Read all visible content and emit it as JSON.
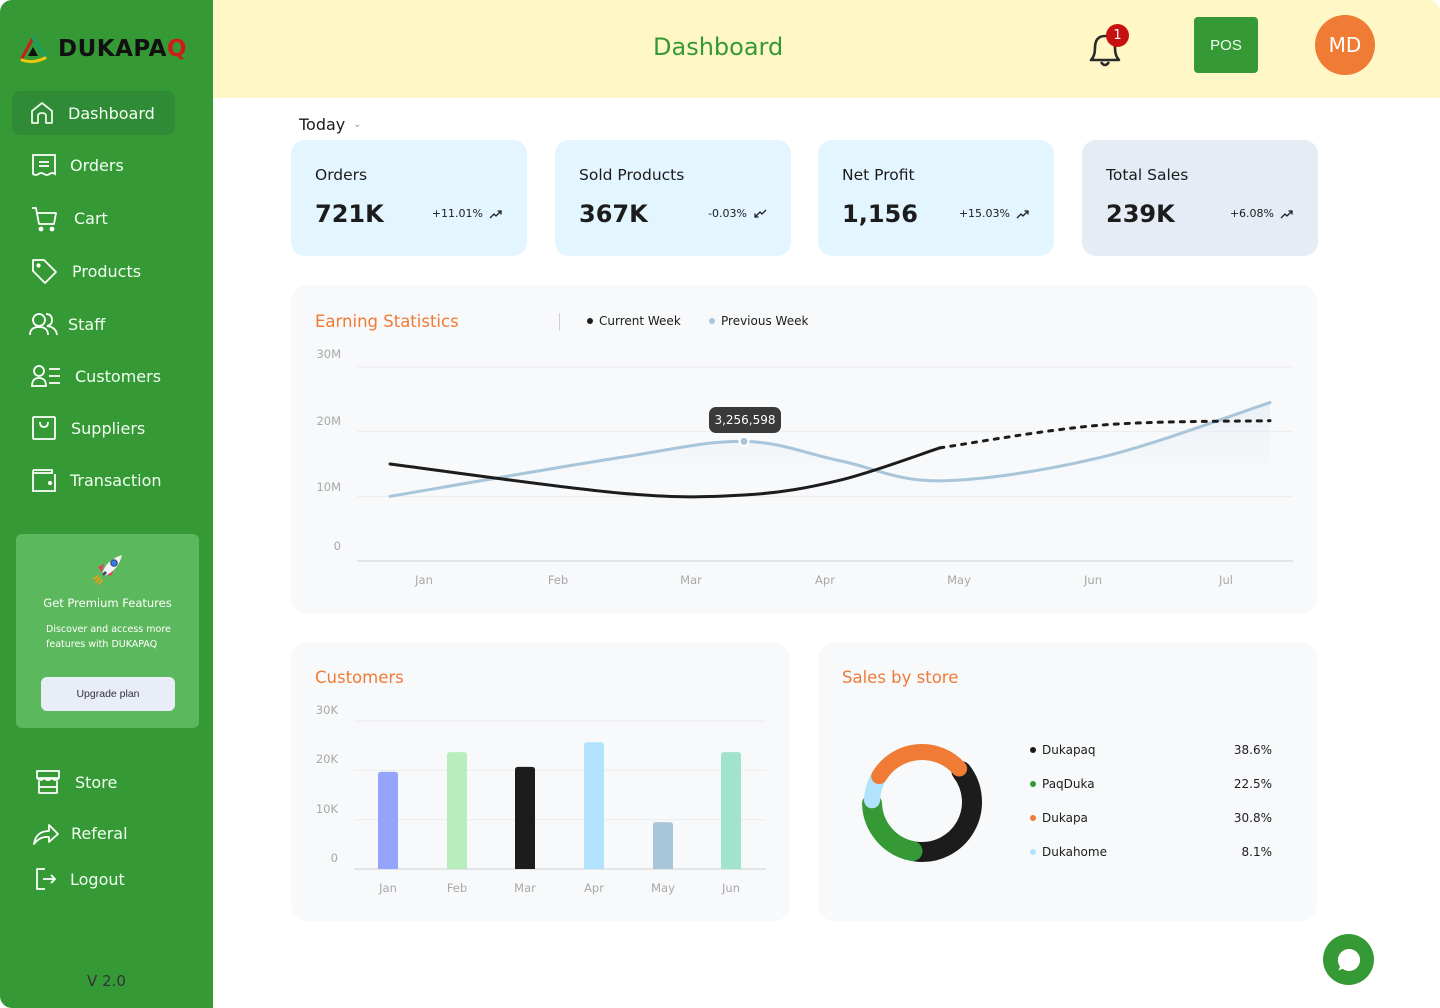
{
  "brand": {
    "name_main": "DUKAPA",
    "name_accent": "Q"
  },
  "sidebar": {
    "items": [
      {
        "label": "Dashboard",
        "icon": "home-icon",
        "active": true
      },
      {
        "label": "Orders",
        "icon": "receipt-icon"
      },
      {
        "label": "Cart",
        "icon": "cart-icon"
      },
      {
        "label": "Products",
        "icon": "tag-icon"
      },
      {
        "label": "Staff",
        "icon": "users-icon"
      },
      {
        "label": "Customers",
        "icon": "user-list-icon"
      },
      {
        "label": "Suppliers",
        "icon": "bag-icon"
      },
      {
        "label": "Transaction",
        "icon": "wallet-icon"
      }
    ],
    "promo": {
      "title": "Get Premium Features",
      "description": "Discover and access more features with DUKAPAQ",
      "button": "Upgrade plan"
    },
    "bottom_items": [
      {
        "label": "Store",
        "icon": "store-icon"
      },
      {
        "label": "Referal",
        "icon": "share-icon"
      },
      {
        "label": "Logout",
        "icon": "logout-icon"
      }
    ],
    "version": "V 2.0"
  },
  "header": {
    "title": "Dashboard",
    "notification_count": "1",
    "pos_label": "POS",
    "avatar_initials": "MD"
  },
  "period_select": {
    "value": "Today"
  },
  "stats": [
    {
      "title": "Orders",
      "value": "721K",
      "change": "+11.01%",
      "trend": "up"
    },
    {
      "title": "Sold Products",
      "value": "367K",
      "change": "-0.03%",
      "trend": "down"
    },
    {
      "title": "Net Profit",
      "value": "1,156",
      "change": "+15.03%",
      "trend": "up"
    },
    {
      "title": "Total Sales",
      "value": "239K",
      "change": "+6.08%",
      "trend": "up"
    }
  ],
  "colors": {
    "brand_green": "#359a35",
    "accent_orange": "#ef7b35",
    "current_week": "#1c1c1c",
    "previous_week": "#a8c5da"
  },
  "chart_data": [
    {
      "type": "line",
      "title": "Earning Statistics",
      "x": [
        "Jan",
        "Feb",
        "Mar",
        "Apr",
        "May",
        "Jun",
        "Jul"
      ],
      "yticks": [
        "0",
        "10M",
        "20M",
        "30M"
      ],
      "ylim": [
        0,
        30
      ],
      "yunit": "M",
      "legend": [
        "Current Week",
        "Previous Week"
      ],
      "series": [
        {
          "name": "Current Week",
          "values": [
            15,
            10.5,
            10.2,
            12.5,
            17.5,
            21,
            21.7
          ],
          "solid_until_index": 4,
          "rest": "dashed"
        },
        {
          "name": "Previous Week",
          "values": [
            10,
            16,
            18.5,
            15.5,
            12.4,
            16,
            24.5
          ]
        }
      ],
      "tooltip": {
        "value": "3,256,598",
        "series": "Previous Week"
      },
      "grid": true
    },
    {
      "type": "bar",
      "title": "Customers",
      "categories": [
        "Jan",
        "Feb",
        "Mar",
        "Apr",
        "May",
        "Jun"
      ],
      "values": [
        19.7,
        23.7,
        20.7,
        25.7,
        9.5,
        23.7
      ],
      "unit": "K",
      "yticks": [
        "0",
        "10K",
        "20K",
        "30K"
      ],
      "ylim": [
        0,
        30
      ],
      "bar_colors": [
        "#95a4fc",
        "#baedbd",
        "#1c1c1c",
        "#b1e3ff",
        "#a8c5da",
        "#a1e3cb"
      ],
      "grid": true
    },
    {
      "type": "pie",
      "title": "Sales by store",
      "labels": [
        "Dukapaq",
        "PaqDuka",
        "Dukapa",
        "Dukahome"
      ],
      "values": [
        38.6,
        22.5,
        30.8,
        8.1
      ],
      "display": [
        "38.6%",
        "22.5%",
        "30.8%",
        "8.1%"
      ],
      "colors": [
        "#1c1c1c",
        "#359a35",
        "#ef7b35",
        "#b1e3ff"
      ],
      "legend": "right"
    }
  ]
}
